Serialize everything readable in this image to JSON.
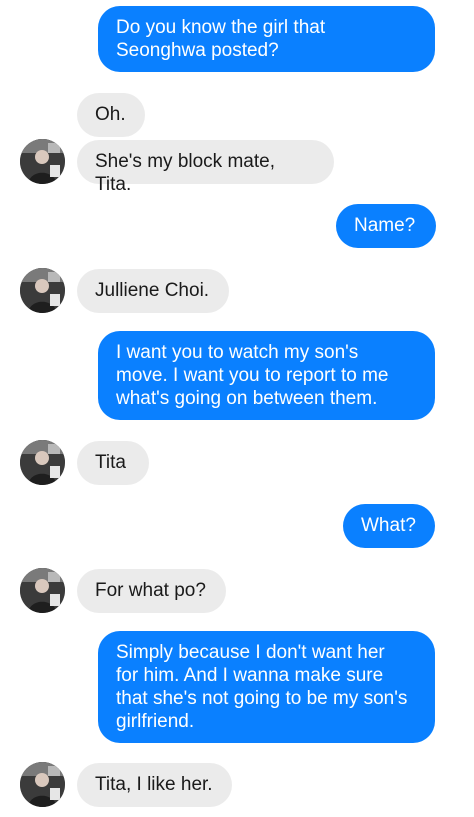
{
  "messages": [
    {
      "side": "sent",
      "text": "Do you know the girl that\nSeonghwa posted?"
    },
    {
      "side": "received",
      "text": "Oh."
    },
    {
      "side": "received",
      "text": "She's my block mate, Tita."
    },
    {
      "side": "sent",
      "text": "Name?"
    },
    {
      "side": "received",
      "text": "Julliene Choi."
    },
    {
      "side": "sent",
      "text": "I want you to watch my son's\nmove. I want you to report to me\nwhat's going on between them."
    },
    {
      "side": "received",
      "text": "Tita"
    },
    {
      "side": "sent",
      "text": "What?"
    },
    {
      "side": "received",
      "text": "For what po?"
    },
    {
      "side": "sent",
      "text": "Simply because I don't want her\nfor him. And I wanna make sure\nthat she's not going to be my son's\ngirlfriend."
    },
    {
      "side": "received",
      "text": "Tita, I like her."
    }
  ],
  "avatar": {
    "icon": "contact-avatar-icon"
  },
  "colors": {
    "sent_bubble": "#0a80ff",
    "received_bubble": "#ebebeb",
    "sent_text": "#ffffff",
    "received_text": "#1a1a1a"
  }
}
